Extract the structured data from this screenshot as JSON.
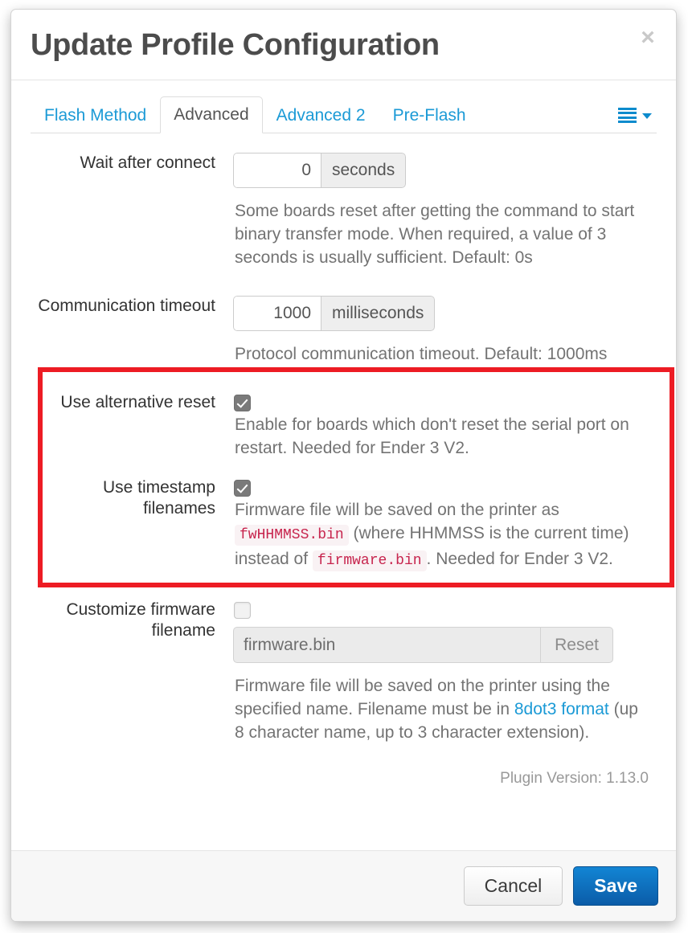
{
  "modal": {
    "title": "Update Profile Configuration",
    "close_label": "×"
  },
  "tabs": [
    {
      "label": "Flash Method",
      "active": false
    },
    {
      "label": "Advanced",
      "active": true
    },
    {
      "label": "Advanced 2",
      "active": false
    },
    {
      "label": "Pre-Flash",
      "active": false
    }
  ],
  "tab_menu": {
    "icon": "hamburger-icon",
    "caret": "chevron-down-icon"
  },
  "fields": {
    "wait_after_connect": {
      "label": "Wait after connect",
      "value": "0",
      "unit": "seconds",
      "help": "Some boards reset after getting the command to start binary transfer mode. When required, a value of 3 seconds is usually sufficient. Default: 0s"
    },
    "communication_timeout": {
      "label": "Communication timeout",
      "value": "1000",
      "unit": "milliseconds",
      "help": "Protocol communication timeout. Default: 1000ms"
    },
    "use_alternative_reset": {
      "label": "Use alternative reset",
      "checked": true,
      "help": "Enable for boards which don't reset the serial port on restart. Needed for Ender 3 V2."
    },
    "use_timestamp_filenames": {
      "label": "Use timestamp filenames",
      "checked": true,
      "help_part1": "Firmware file will be saved on the printer as",
      "code1": "fwHHMMSS.bin",
      "help_part2": "(where HHMMSS is the current time) instead of",
      "code2": "firmware.bin",
      "help_part3": ". Needed for Ender 3 V2."
    },
    "customize_firmware_filename": {
      "label": "Customize firmware filename",
      "checked": false,
      "value": "firmware.bin",
      "reset_label": "Reset",
      "help_part1": "Firmware file will be saved on the printer using the specified name. Filename must be in",
      "link_text": "8dot3 format",
      "help_part2": "(up 8 character name, up to 3 character extension)."
    }
  },
  "plugin_version": "Plugin Version: 1.13.0",
  "footer": {
    "cancel_label": "Cancel",
    "save_label": "Save"
  },
  "colors": {
    "link": "#1b9ad6",
    "highlight_border": "#ed1c24",
    "primary_button": "#1285d4",
    "code_text": "#c7254e",
    "code_bg": "#f9f2f4"
  }
}
